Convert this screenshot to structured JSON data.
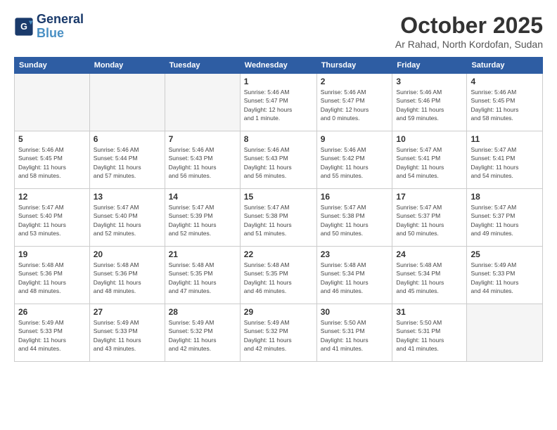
{
  "header": {
    "logo_line1": "General",
    "logo_line2": "Blue",
    "month": "October 2025",
    "location": "Ar Rahad, North Kordofan, Sudan"
  },
  "weekdays": [
    "Sunday",
    "Monday",
    "Tuesday",
    "Wednesday",
    "Thursday",
    "Friday",
    "Saturday"
  ],
  "weeks": [
    [
      {
        "day": "",
        "info": ""
      },
      {
        "day": "",
        "info": ""
      },
      {
        "day": "",
        "info": ""
      },
      {
        "day": "1",
        "info": "Sunrise: 5:46 AM\nSunset: 5:47 PM\nDaylight: 12 hours\nand 1 minute."
      },
      {
        "day": "2",
        "info": "Sunrise: 5:46 AM\nSunset: 5:47 PM\nDaylight: 12 hours\nand 0 minutes."
      },
      {
        "day": "3",
        "info": "Sunrise: 5:46 AM\nSunset: 5:46 PM\nDaylight: 11 hours\nand 59 minutes."
      },
      {
        "day": "4",
        "info": "Sunrise: 5:46 AM\nSunset: 5:45 PM\nDaylight: 11 hours\nand 58 minutes."
      }
    ],
    [
      {
        "day": "5",
        "info": "Sunrise: 5:46 AM\nSunset: 5:45 PM\nDaylight: 11 hours\nand 58 minutes."
      },
      {
        "day": "6",
        "info": "Sunrise: 5:46 AM\nSunset: 5:44 PM\nDaylight: 11 hours\nand 57 minutes."
      },
      {
        "day": "7",
        "info": "Sunrise: 5:46 AM\nSunset: 5:43 PM\nDaylight: 11 hours\nand 56 minutes."
      },
      {
        "day": "8",
        "info": "Sunrise: 5:46 AM\nSunset: 5:43 PM\nDaylight: 11 hours\nand 56 minutes."
      },
      {
        "day": "9",
        "info": "Sunrise: 5:46 AM\nSunset: 5:42 PM\nDaylight: 11 hours\nand 55 minutes."
      },
      {
        "day": "10",
        "info": "Sunrise: 5:47 AM\nSunset: 5:41 PM\nDaylight: 11 hours\nand 54 minutes."
      },
      {
        "day": "11",
        "info": "Sunrise: 5:47 AM\nSunset: 5:41 PM\nDaylight: 11 hours\nand 54 minutes."
      }
    ],
    [
      {
        "day": "12",
        "info": "Sunrise: 5:47 AM\nSunset: 5:40 PM\nDaylight: 11 hours\nand 53 minutes."
      },
      {
        "day": "13",
        "info": "Sunrise: 5:47 AM\nSunset: 5:40 PM\nDaylight: 11 hours\nand 52 minutes."
      },
      {
        "day": "14",
        "info": "Sunrise: 5:47 AM\nSunset: 5:39 PM\nDaylight: 11 hours\nand 52 minutes."
      },
      {
        "day": "15",
        "info": "Sunrise: 5:47 AM\nSunset: 5:38 PM\nDaylight: 11 hours\nand 51 minutes."
      },
      {
        "day": "16",
        "info": "Sunrise: 5:47 AM\nSunset: 5:38 PM\nDaylight: 11 hours\nand 50 minutes."
      },
      {
        "day": "17",
        "info": "Sunrise: 5:47 AM\nSunset: 5:37 PM\nDaylight: 11 hours\nand 50 minutes."
      },
      {
        "day": "18",
        "info": "Sunrise: 5:47 AM\nSunset: 5:37 PM\nDaylight: 11 hours\nand 49 minutes."
      }
    ],
    [
      {
        "day": "19",
        "info": "Sunrise: 5:48 AM\nSunset: 5:36 PM\nDaylight: 11 hours\nand 48 minutes."
      },
      {
        "day": "20",
        "info": "Sunrise: 5:48 AM\nSunset: 5:36 PM\nDaylight: 11 hours\nand 48 minutes."
      },
      {
        "day": "21",
        "info": "Sunrise: 5:48 AM\nSunset: 5:35 PM\nDaylight: 11 hours\nand 47 minutes."
      },
      {
        "day": "22",
        "info": "Sunrise: 5:48 AM\nSunset: 5:35 PM\nDaylight: 11 hours\nand 46 minutes."
      },
      {
        "day": "23",
        "info": "Sunrise: 5:48 AM\nSunset: 5:34 PM\nDaylight: 11 hours\nand 46 minutes."
      },
      {
        "day": "24",
        "info": "Sunrise: 5:48 AM\nSunset: 5:34 PM\nDaylight: 11 hours\nand 45 minutes."
      },
      {
        "day": "25",
        "info": "Sunrise: 5:49 AM\nSunset: 5:33 PM\nDaylight: 11 hours\nand 44 minutes."
      }
    ],
    [
      {
        "day": "26",
        "info": "Sunrise: 5:49 AM\nSunset: 5:33 PM\nDaylight: 11 hours\nand 44 minutes."
      },
      {
        "day": "27",
        "info": "Sunrise: 5:49 AM\nSunset: 5:33 PM\nDaylight: 11 hours\nand 43 minutes."
      },
      {
        "day": "28",
        "info": "Sunrise: 5:49 AM\nSunset: 5:32 PM\nDaylight: 11 hours\nand 42 minutes."
      },
      {
        "day": "29",
        "info": "Sunrise: 5:49 AM\nSunset: 5:32 PM\nDaylight: 11 hours\nand 42 minutes."
      },
      {
        "day": "30",
        "info": "Sunrise: 5:50 AM\nSunset: 5:31 PM\nDaylight: 11 hours\nand 41 minutes."
      },
      {
        "day": "31",
        "info": "Sunrise: 5:50 AM\nSunset: 5:31 PM\nDaylight: 11 hours\nand 41 minutes."
      },
      {
        "day": "",
        "info": ""
      }
    ]
  ]
}
